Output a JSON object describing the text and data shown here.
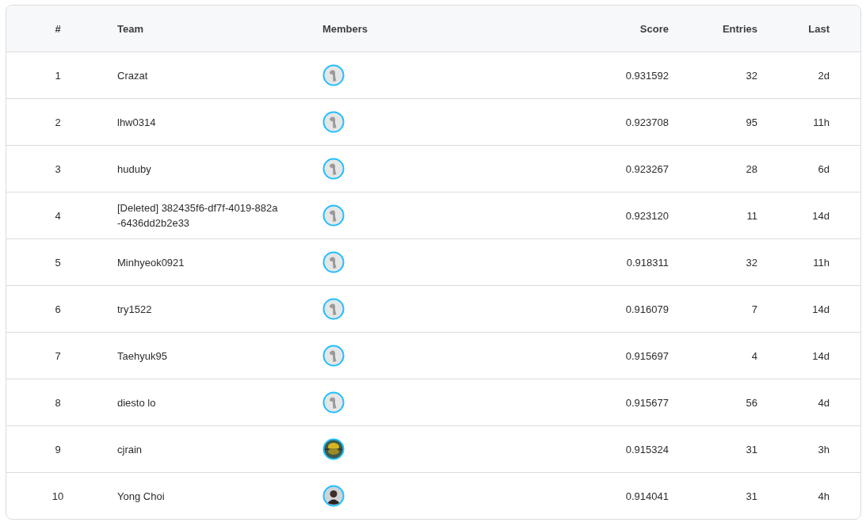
{
  "table": {
    "columns": [
      "#",
      "Team",
      "Members",
      "Score",
      "Entries",
      "Last"
    ],
    "rows": [
      {
        "rank": "1",
        "team": "Crazat",
        "members": [
          {
            "kind": "default"
          }
        ],
        "score": "0.931592",
        "entries": "32",
        "last": "2d"
      },
      {
        "rank": "2",
        "team": "lhw0314",
        "members": [
          {
            "kind": "default"
          }
        ],
        "score": "0.923708",
        "entries": "95",
        "last": "11h"
      },
      {
        "rank": "3",
        "team": "huduby",
        "members": [
          {
            "kind": "default"
          }
        ],
        "score": "0.923267",
        "entries": "28",
        "last": "6d"
      },
      {
        "rank": "4",
        "team": "[Deleted] 382435f6-df7f-4019-882a-6436dd2b2e33",
        "members": [
          {
            "kind": "default"
          }
        ],
        "score": "0.923120",
        "entries": "11",
        "last": "14d"
      },
      {
        "rank": "5",
        "team": "Minhyeok0921",
        "members": [
          {
            "kind": "default"
          }
        ],
        "score": "0.918311",
        "entries": "32",
        "last": "11h"
      },
      {
        "rank": "6",
        "team": "try1522",
        "members": [
          {
            "kind": "default"
          }
        ],
        "score": "0.916079",
        "entries": "7",
        "last": "14d"
      },
      {
        "rank": "7",
        "team": "Taehyuk95",
        "members": [
          {
            "kind": "default"
          }
        ],
        "score": "0.915697",
        "entries": "4",
        "last": "14d"
      },
      {
        "rank": "8",
        "team": "diesto lo",
        "members": [
          {
            "kind": "default"
          }
        ],
        "score": "0.915677",
        "entries": "56",
        "last": "4d"
      },
      {
        "rank": "9",
        "team": "cjrain",
        "members": [
          {
            "kind": "landscape"
          }
        ],
        "score": "0.915324",
        "entries": "31",
        "last": "3h"
      },
      {
        "rank": "10",
        "team": "Yong Choi",
        "members": [
          {
            "kind": "person"
          }
        ],
        "score": "0.914041",
        "entries": "31",
        "last": "4h"
      }
    ]
  }
}
